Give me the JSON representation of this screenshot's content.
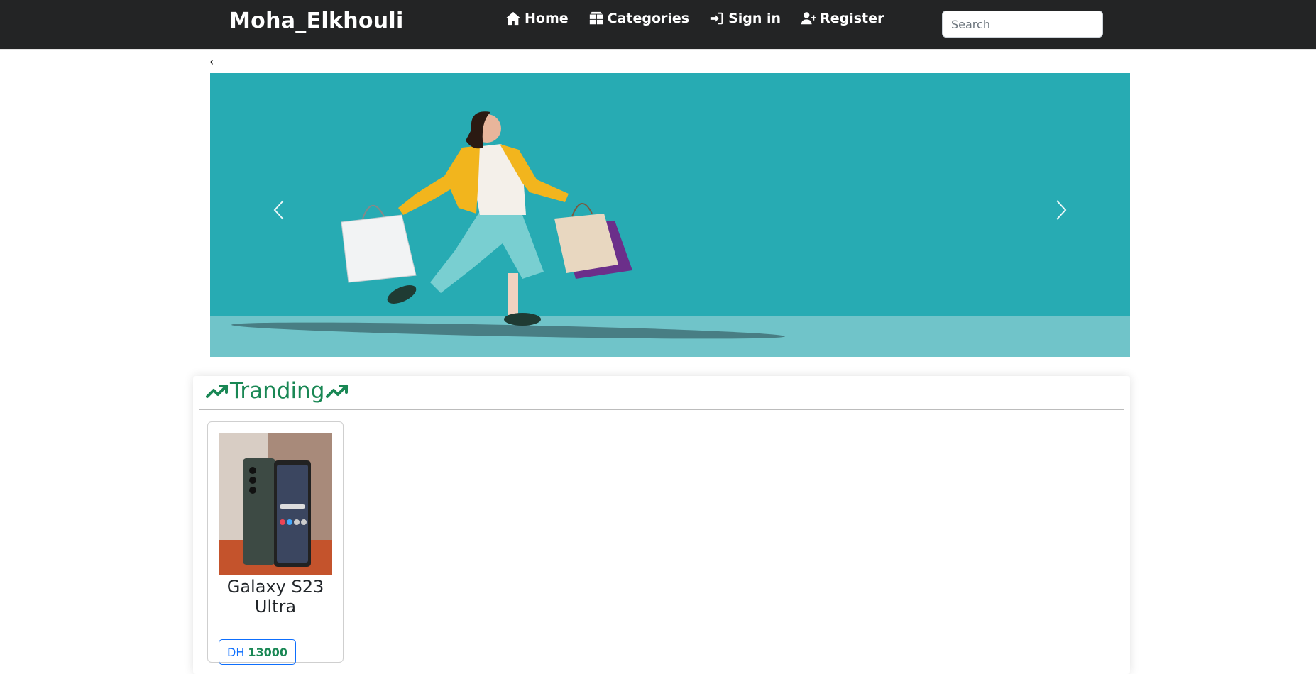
{
  "navbar": {
    "brand": "Moha_Elkhouli",
    "items": [
      {
        "label": "Home",
        "icon": "home-icon"
      },
      {
        "label": "Categories",
        "icon": "boxes-icon"
      },
      {
        "label": "Sign in",
        "icon": "sign-in-icon"
      },
      {
        "label": "Register",
        "icon": "user-plus-icon"
      }
    ],
    "search_placeholder": "Search"
  },
  "back_link": "‹",
  "carousel": {
    "accent_color": "#27abb3",
    "prev_icon": "chevron-left-icon",
    "next_icon": "chevron-right-icon"
  },
  "trending": {
    "title": "Tranding",
    "title_color": "#198754",
    "icon": "arrow-trend-up-icon",
    "products": [
      {
        "name": "Galaxy S23 Ultra",
        "currency": "DH",
        "price": "13000"
      }
    ]
  }
}
